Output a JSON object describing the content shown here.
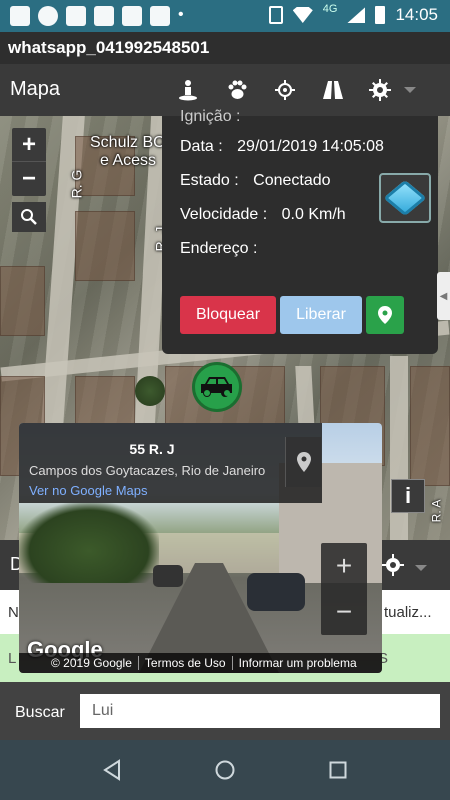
{
  "status_bar": {
    "network": "4G",
    "time": "14:05"
  },
  "window": {
    "title": "whatsapp_041992548501"
  },
  "app_bar": {
    "title": "Mapa",
    "icons": [
      "person-pin-icon",
      "paw-icon",
      "crosshair-icon",
      "road-icon",
      "gear-icon",
      "dropdown-icon"
    ]
  },
  "map": {
    "labels": [
      "Schulz BO",
      "e Acess",
      "R. G",
      "R. J",
      "R. A"
    ]
  },
  "info_panel": {
    "partial_label": "Ignição :",
    "rows": [
      {
        "label": "Data :",
        "value": "29/01/2019 14:05:08"
      },
      {
        "label": "Estado :",
        "value": "Conectado"
      },
      {
        "label": "Velocidade :",
        "value": "0.0 Km/h"
      },
      {
        "label": "Endereço :",
        "value": ""
      }
    ],
    "buttons": {
      "block": "Bloquear",
      "release": "Liberar"
    },
    "colors": {
      "block": "#d9344a",
      "release": "#9ec7ec",
      "location": "#2aa24a"
    }
  },
  "street_view": {
    "title": "55 R. J",
    "subtitle": "Campos dos Goytacazes, Rio de Janeiro",
    "link": "Ver no Google Maps",
    "logo": "Google",
    "footer": [
      "© 2019 Google",
      "Termos de Uso",
      "Informar um problema"
    ]
  },
  "list_area": {
    "header_partial": "D",
    "row1_left": "N",
    "row1_right": "tualiz...",
    "row2_left": "L",
    "row2_right": "S"
  },
  "search": {
    "label": "Buscar",
    "value": "Lui"
  }
}
